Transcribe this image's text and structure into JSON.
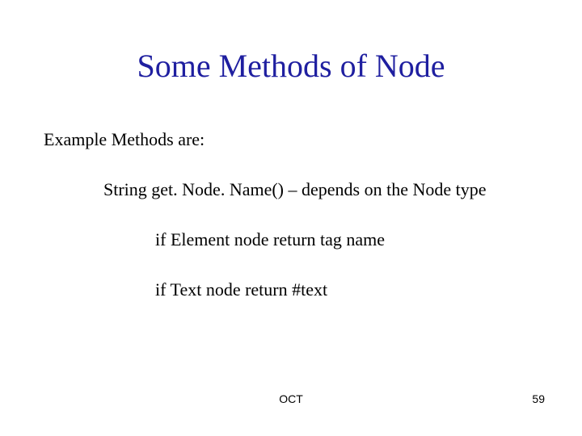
{
  "title": "Some Methods of Node",
  "body": {
    "intro": "Example Methods are:",
    "method1": "String get. Node. Name() – depends on the Node type",
    "method1_sub1": "if Element node return tag name",
    "method1_sub2": "if Text node return #text"
  },
  "footer": {
    "center": "OCT",
    "page": "59"
  }
}
